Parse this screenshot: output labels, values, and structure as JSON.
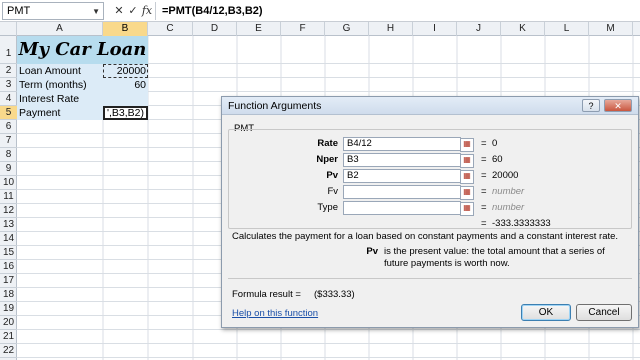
{
  "formula_bar": {
    "name_box": "PMT",
    "cancel": "✕",
    "enter": "✓",
    "fx": "fx",
    "formula": "=PMT(B4/12,B3,B2)"
  },
  "columns": [
    "A",
    "B",
    "C",
    "D",
    "E",
    "F",
    "G",
    "H",
    "I",
    "J",
    "K",
    "L",
    "M"
  ],
  "selected_column": "B",
  "rows": [
    "1",
    "2",
    "3",
    "4",
    "5",
    "6",
    "7",
    "8",
    "9",
    "10",
    "11",
    "12",
    "13",
    "14",
    "15",
    "16",
    "17",
    "18",
    "19",
    "20",
    "21",
    "22"
  ],
  "selected_row": "5",
  "sheet": {
    "title": "My Car Loan",
    "labels": [
      "Loan Amount",
      "Term (months)",
      "Interest Rate",
      "Payment"
    ],
    "b2": "20000",
    "b3": "60",
    "b4": "",
    "b5": "',B3,B2)"
  },
  "dialog": {
    "title": "Function Arguments",
    "help_button": "?",
    "close_button": "✕",
    "function_name": "PMT",
    "args": [
      {
        "label": "Rate",
        "input": "B4/12",
        "value": "0",
        "required": true
      },
      {
        "label": "Nper",
        "input": "B3",
        "value": "60",
        "required": true
      },
      {
        "label": "Pv",
        "input": "B2",
        "value": "20000",
        "required": true
      },
      {
        "label": "Fv",
        "input": "",
        "value": "number",
        "required": false
      },
      {
        "label": "Type",
        "input": "",
        "value": "number",
        "required": false
      }
    ],
    "equals": "=",
    "result_value": "-333.3333333",
    "description": "Calculates the payment for a loan based on constant payments and a constant interest rate.",
    "arg_help_name": "Pv",
    "arg_help_text": "is the present value: the total amount that a series of future payments is worth now.",
    "formula_result_label": "Formula result =",
    "formula_result_value": "($333.33)",
    "help_link": "Help on this function",
    "ok_label": "OK",
    "cancel_label": "Cancel"
  }
}
